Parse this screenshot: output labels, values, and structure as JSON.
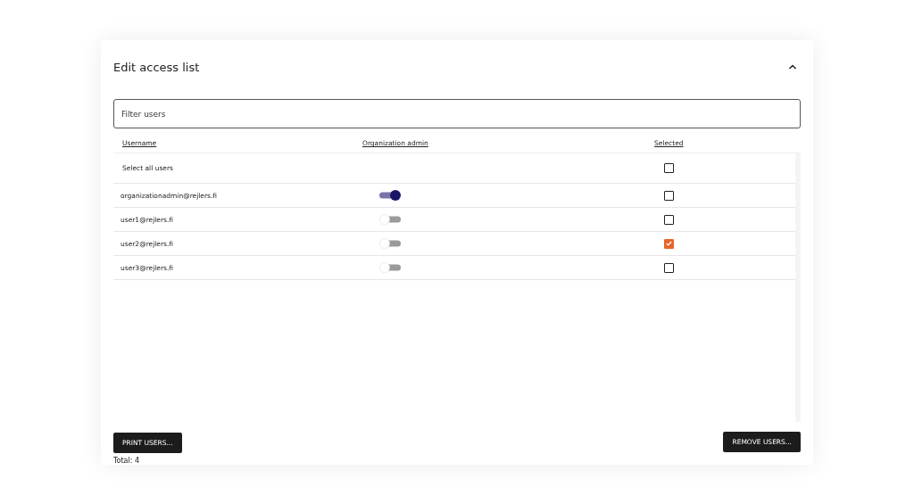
{
  "panel": {
    "title": "Edit access list",
    "expanded": true
  },
  "filter": {
    "placeholder": "Filter users"
  },
  "table": {
    "columns": [
      "Username",
      "Organization admin",
      "Selected"
    ],
    "select_all": {
      "label": "Select all users",
      "checked": false
    },
    "rows": [
      {
        "username": "organizationadmin@rejlers.fi",
        "admin": true,
        "selected": false
      },
      {
        "username": "user1@rejlers.fi",
        "admin": false,
        "selected": false
      },
      {
        "username": "user2@rejlers.fi",
        "admin": false,
        "selected": true
      },
      {
        "username": "user3@rejlers.fi",
        "admin": false,
        "selected": false
      }
    ]
  },
  "buttons": {
    "print": "PRINT USERS...",
    "remove": "REMOVE USERS..."
  },
  "total": "Total: 4"
}
